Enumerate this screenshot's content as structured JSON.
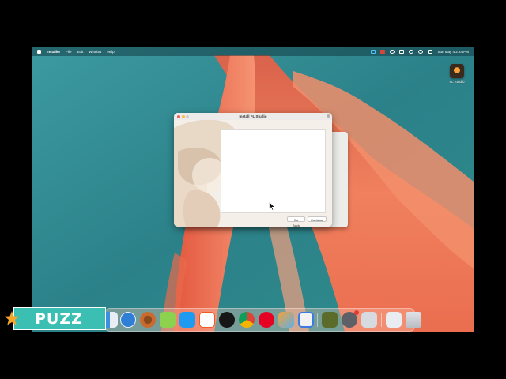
{
  "menubar": {
    "app_name": "Installer",
    "menus": [
      "File",
      "Edit",
      "Window",
      "Help"
    ],
    "clock": "Sun May 4  2:24 PM",
    "status_icons": [
      "screen-record-icon",
      "record-stop-icon",
      "power-icon",
      "battery-icon",
      "wifi-icon",
      "search-icon",
      "control-center-icon"
    ]
  },
  "desktop": {
    "icons": [
      {
        "label": "FL Studio",
        "icon": "fl-studio-icon"
      }
    ]
  },
  "installer_window": {
    "title": "Install FL Studio",
    "buttons": {
      "back": "Go Back",
      "continue": "Continue"
    }
  },
  "dock": {
    "apps": [
      "finder",
      "safari",
      "chrome-canary",
      "messages",
      "app-store",
      "brave",
      "beta",
      "chrome",
      "pinterest",
      "launchpad",
      "roblox",
      "camtasia",
      "system-settings",
      "installer",
      "downloads",
      "trash"
    ]
  },
  "watermark": {
    "text": "PUZZ"
  },
  "colors": {
    "wallpaper_teal": "#2f8a8f",
    "wallpaper_coral": "#ee7a5a",
    "watermark_teal": "#3bbfb2",
    "traffic_red": "#ee5f57",
    "traffic_yellow": "#f5bd4f"
  }
}
